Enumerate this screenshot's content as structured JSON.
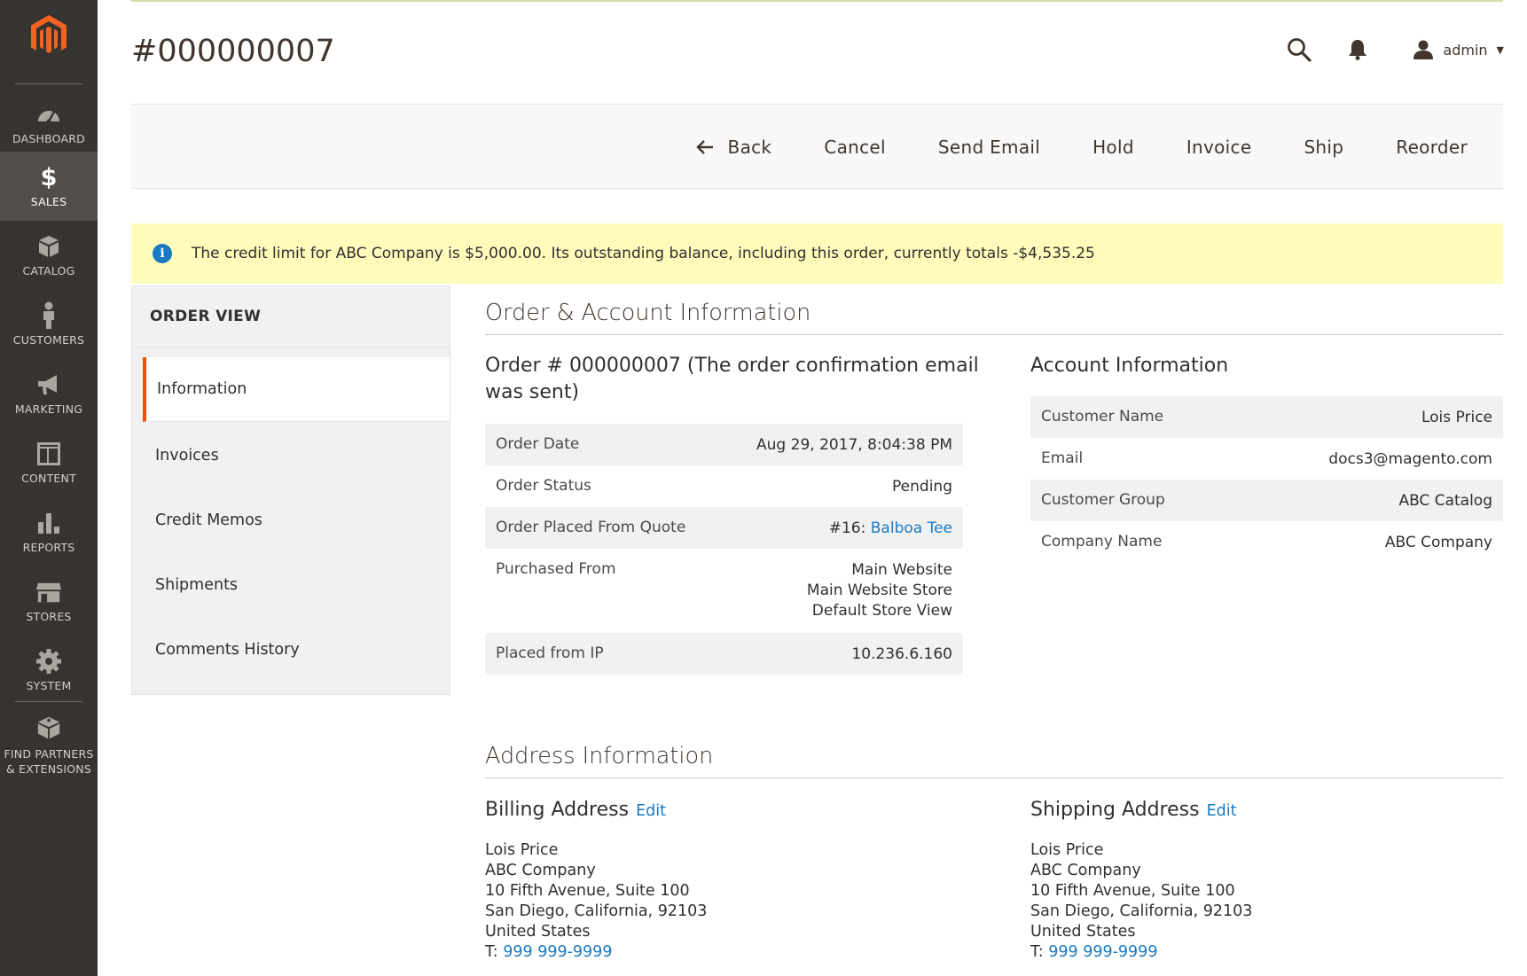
{
  "sidebar": {
    "items": [
      {
        "label": "DASHBOARD",
        "icon": "dashboard-icon"
      },
      {
        "label": "SALES",
        "icon": "dollar-icon",
        "active": true
      },
      {
        "label": "CATALOG",
        "icon": "box-icon"
      },
      {
        "label": "CUSTOMERS",
        "icon": "person-icon"
      },
      {
        "label": "MARKETING",
        "icon": "megaphone-icon"
      },
      {
        "label": "CONTENT",
        "icon": "layout-icon"
      },
      {
        "label": "REPORTS",
        "icon": "bar-chart-icon"
      },
      {
        "label": "STORES",
        "icon": "storefront-icon"
      },
      {
        "label": "SYSTEM",
        "icon": "gear-icon"
      }
    ],
    "partners_line1": "FIND PARTNERS",
    "partners_line2": "& EXTENSIONS"
  },
  "header": {
    "title": "#000000007",
    "user": "admin"
  },
  "actions": {
    "back": "Back",
    "cancel": "Cancel",
    "send_email": "Send Email",
    "hold": "Hold",
    "invoice": "Invoice",
    "ship": "Ship",
    "reorder": "Reorder"
  },
  "notice": "The credit limit for ABC Company is $5,000.00. Its outstanding balance, including this order, currently totals -$4,535.25",
  "tabs": {
    "title": "ORDER VIEW",
    "items": [
      "Information",
      "Invoices",
      "Credit Memos",
      "Shipments",
      "Comments History"
    ]
  },
  "order_section": {
    "title": "Order & Account Information",
    "order_heading_line1": "Order # 000000007 (The order confirmation email",
    "order_heading_line2": "was sent)",
    "rows": {
      "order_date": {
        "label": "Order Date",
        "value": "Aug 29, 2017, 8:04:38 PM"
      },
      "order_status": {
        "label": "Order Status",
        "value": "Pending"
      },
      "quote": {
        "label": "Order Placed From Quote",
        "prefix": "#16: ",
        "link": "Balboa Tee"
      },
      "purchased_from": {
        "label": "Purchased From",
        "line1": "Main Website",
        "line2": "Main Website Store",
        "line3": "Default Store View"
      },
      "ip": {
        "label": "Placed from IP",
        "value": "10.236.6.160"
      }
    },
    "account_heading": "Account Information",
    "account_rows": {
      "customer_name": {
        "label": "Customer Name",
        "value": "Lois Price"
      },
      "email": {
        "label": "Email",
        "value": "docs3@magento.com"
      },
      "customer_group": {
        "label": "Customer Group",
        "value": "ABC Catalog"
      },
      "company_name": {
        "label": "Company Name",
        "value": "ABC Company"
      }
    }
  },
  "address_section": {
    "title": "Address Information",
    "edit_label": "Edit",
    "billing": {
      "heading": "Billing Address",
      "name": "Lois Price",
      "company": "ABC Company",
      "street": "10 Fifth Avenue, Suite 100",
      "city": "San Diego, California, 92103",
      "country": "United States",
      "phone_prefix": "T: ",
      "phone": "999 999-9999"
    },
    "shipping": {
      "heading": "Shipping Address",
      "name": "Lois Price",
      "company": "ABC Company",
      "street": "10 Fifth Avenue, Suite 100",
      "city": "San Diego, California, 92103",
      "country": "United States",
      "phone_prefix": "T: ",
      "phone": "999 999-9999"
    }
  },
  "colors": {
    "sidebar": "#373330",
    "sidebar_active": "#524d49",
    "accent": "#eb5202",
    "link": "#1979c3",
    "notice_bg": "#fffbbb"
  }
}
